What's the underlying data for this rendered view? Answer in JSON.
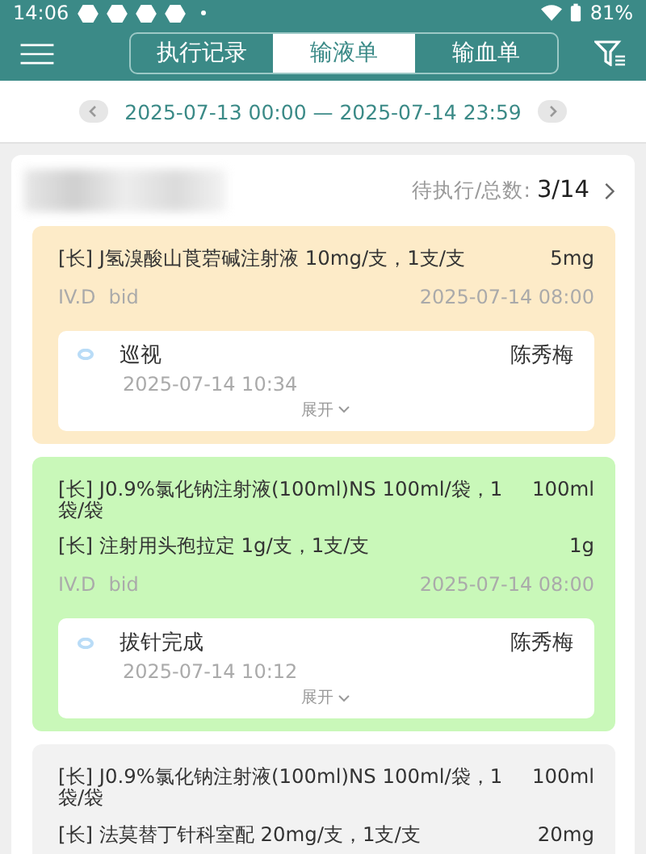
{
  "status_bar": {
    "time": "14:06",
    "battery": "81%"
  },
  "tabs": [
    {
      "label": "执行记录",
      "selected": false
    },
    {
      "label": "输液单",
      "selected": true
    },
    {
      "label": "输血单",
      "selected": false
    }
  ],
  "date_range": {
    "text": "2025-07-13 00:00 — 2025-07-14 23:59"
  },
  "summary": {
    "label": "待执行/总数:",
    "count": "3/14"
  },
  "cards": [
    {
      "color": "#fdebc8",
      "drugs": [
        {
          "name": "[长] J氢溴酸山莨菪碱注射液 10mg/支，1支/支",
          "dose": "5mg"
        }
      ],
      "route": "IV.D",
      "freq": "bid",
      "time": "2025-07-14 08:00",
      "record": {
        "action": "巡视",
        "nurse": "陈秀梅",
        "time": "2025-07-14 10:34",
        "expand": "展开"
      }
    },
    {
      "color": "#c9f8b9",
      "drugs": [
        {
          "name": "[长] J0.9%氯化钠注射液(100ml)NS 100ml/袋，1袋/袋",
          "dose": "100ml"
        },
        {
          "name": "[长] 注射用头孢拉定 1g/支，1支/支",
          "dose": "1g"
        }
      ],
      "route": "IV.D",
      "freq": "bid",
      "time": "2025-07-14 08:00",
      "record": {
        "action": "拔针完成",
        "nurse": "陈秀梅",
        "time": "2025-07-14 10:12",
        "expand": "展开"
      }
    },
    {
      "color": "#f2f2f2",
      "drugs": [
        {
          "name": "[长] J0.9%氯化钠注射液(100ml)NS 100ml/袋，1袋/袋",
          "dose": "100ml"
        },
        {
          "name": "[长] 法莫替丁针科室配 20mg/支，1支/支",
          "dose": "20mg"
        }
      ]
    }
  ]
}
